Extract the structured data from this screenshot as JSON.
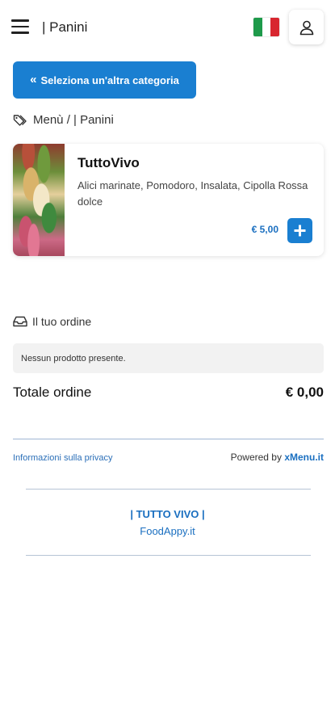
{
  "header": {
    "title": "| Panini",
    "menu_icon": "hamburger-icon",
    "flag_icon": "italy-flag-icon",
    "flag_colors": [
      "#1e9a4a",
      "#ffffff",
      "#d8262f"
    ],
    "user_icon": "user-icon"
  },
  "back_button": {
    "label": "Seleziona un'altra categoria",
    "icon": "double-chevron-left-icon"
  },
  "breadcrumb": {
    "icon": "tags-icon",
    "text": "Menù / | Panini"
  },
  "products": [
    {
      "name": "TuttoVivo",
      "description": "Alici marinate, Pomodoro, Insalata, Cipolla Rossa dolce",
      "price": "€ 5,00",
      "add_icon": "plus-icon"
    }
  ],
  "order": {
    "heading": "Il tuo ordine",
    "icon": "inbox-icon",
    "empty_message": "Nessun prodotto presente.",
    "total_label": "Totale ordine",
    "total_value": "€ 0,00"
  },
  "footer": {
    "privacy_label": "Informazioni sulla privacy",
    "powered_prefix": "Powered by",
    "powered_brand": "xMenu.it",
    "restaurant_name": "| TUTTO VIVO |",
    "site": "FoodAppy.it"
  },
  "colors": {
    "accent": "#1a7fd1",
    "link": "#1a6fc0",
    "empty_bg": "#f2f2f2"
  }
}
